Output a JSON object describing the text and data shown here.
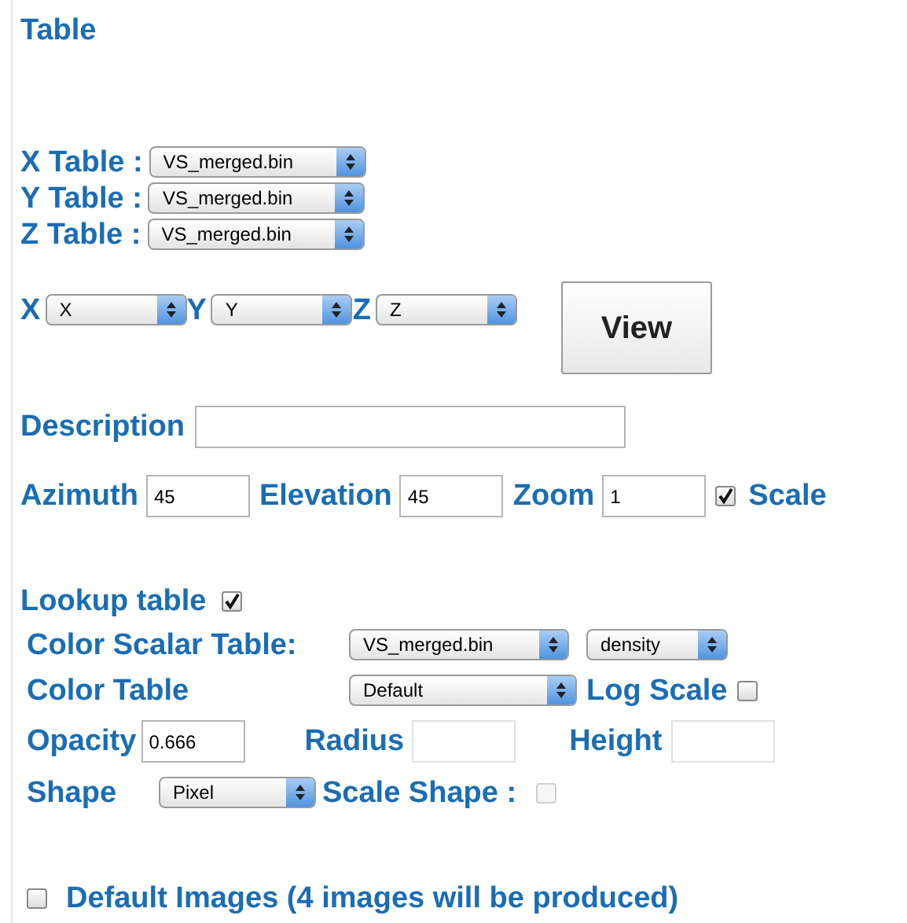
{
  "title": "Table",
  "table_selects": [
    {
      "label": "X Table :",
      "value": "VS_merged.bin"
    },
    {
      "label": "Y Table :",
      "value": "VS_merged.bin"
    },
    {
      "label": "Z Table :",
      "value": "VS_merged.bin"
    }
  ],
  "axes": [
    {
      "label": "X",
      "value": "X"
    },
    {
      "label": "Y",
      "value": "Y"
    },
    {
      "label": "Z",
      "value": "Z"
    }
  ],
  "view_button": "View",
  "description": {
    "label": "Description"
  },
  "camera": [
    {
      "label": "Azimuth",
      "value": "45"
    },
    {
      "label": "Elevation",
      "value": "45"
    },
    {
      "label": "Zoom",
      "value": "1"
    }
  ],
  "scale": {
    "label": "Scale",
    "checked": true
  },
  "lookup_table": {
    "label": "Lookup table",
    "checked": true
  },
  "color_scalar_table": {
    "label": "Color Scalar Table:",
    "table": "VS_merged.bin",
    "field": "density"
  },
  "color_table": {
    "label": "Color Table",
    "value": "Default"
  },
  "log_scale": {
    "label": "Log Scale",
    "checked": false
  },
  "opacity": {
    "label": "Opacity",
    "value": "0.666"
  },
  "radius": {
    "label": "Radius",
    "disabled": true
  },
  "height": {
    "label": "Height",
    "disabled": true
  },
  "shape": {
    "label": "Shape",
    "value": "Pixel"
  },
  "scale_shape": {
    "label": "Scale Shape :",
    "checked": false,
    "disabled": true
  },
  "default_images": {
    "label": "Default Images (4 images will be produced)",
    "checked": false
  }
}
